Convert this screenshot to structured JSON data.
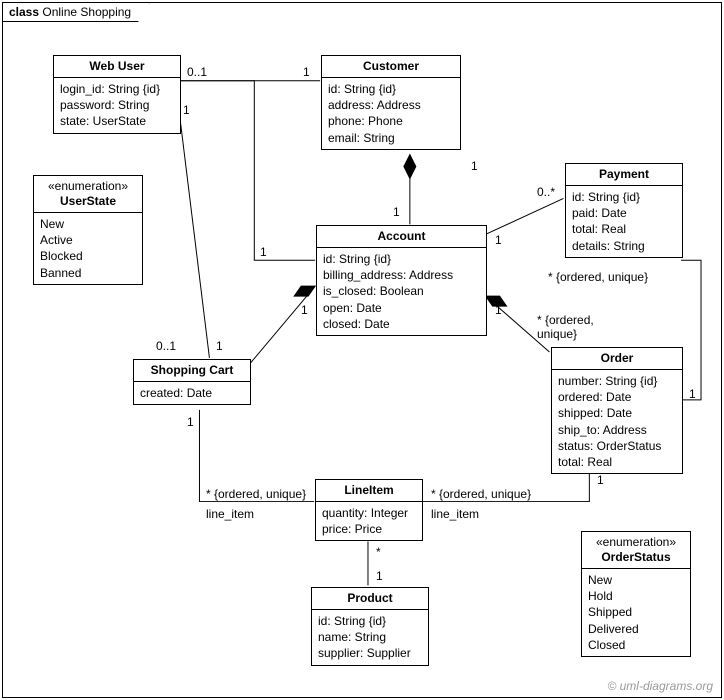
{
  "frame": {
    "kind": "class",
    "title": "Online Shopping"
  },
  "classes": {
    "webuser": {
      "name": "Web User",
      "attrs": [
        "login_id: String {id}",
        "password: String",
        "state: UserState"
      ]
    },
    "customer": {
      "name": "Customer",
      "attrs": [
        "id: String {id}",
        "address: Address",
        "phone: Phone",
        "email: String"
      ]
    },
    "payment": {
      "name": "Payment",
      "attrs": [
        "id: String {id}",
        "paid: Date",
        "total: Real",
        "details: String"
      ]
    },
    "userstate": {
      "stereo": "«enumeration»",
      "name": "UserState",
      "attrs": [
        "New",
        "Active",
        "Blocked",
        "Banned"
      ]
    },
    "account": {
      "name": "Account",
      "attrs": [
        "id: String {id}",
        "billing_address: Address",
        "is_closed: Boolean",
        "open: Date",
        "closed: Date"
      ]
    },
    "shoppingcart": {
      "name": "Shopping Cart",
      "attrs": [
        "created: Date"
      ]
    },
    "order": {
      "name": "Order",
      "attrs": [
        "number: String {id}",
        "ordered: Date",
        "shipped: Date",
        "ship_to: Address",
        "status: OrderStatus",
        "total: Real"
      ]
    },
    "lineitem": {
      "name": "LineItem",
      "attrs": [
        "quantity: Integer",
        "price: Price"
      ]
    },
    "orderstatus": {
      "stereo": "«enumeration»",
      "name": "OrderStatus",
      "attrs": [
        "New",
        "Hold",
        "Shipped",
        "Delivered",
        "Closed"
      ]
    },
    "product": {
      "name": "Product",
      "attrs": [
        "id: String {id}",
        "name: String",
        "supplier: Supplier"
      ]
    }
  },
  "labels": {
    "m_0_1": "0..1",
    "m_1": "1",
    "m_0_star": "0..*",
    "m_star": "*",
    "ordered_unique_star": "* {ordered, unique}",
    "ordered_unique": "{ordered,\nunique}",
    "line_item": "line_item"
  },
  "watermark": "© uml-diagrams.org"
}
